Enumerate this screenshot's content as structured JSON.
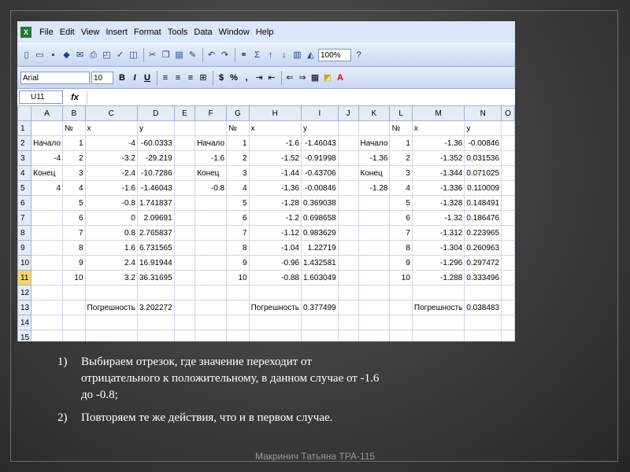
{
  "menu": [
    "File",
    "Edit",
    "View",
    "Insert",
    "Format",
    "Tools",
    "Data",
    "Window",
    "Help"
  ],
  "toolbar": {
    "zoom": "100%"
  },
  "format_toolbar": {
    "font": "Arial",
    "size": "10",
    "bold": "B",
    "italic": "I",
    "underline": "U",
    "currency": "$",
    "percent": "%",
    "comma": ","
  },
  "formula_bar": {
    "name_box": "U11",
    "fx": "fx"
  },
  "columns": [
    "A",
    "B",
    "C",
    "D",
    "E",
    "F",
    "G",
    "H",
    "I",
    "J",
    "K",
    "L",
    "M",
    "N",
    "O"
  ],
  "rows": [
    {
      "n": "1",
      "c": [
        "",
        "№",
        "x",
        "y",
        "",
        "",
        "№",
        "x",
        "y",
        "",
        "",
        "№",
        "x",
        "y",
        ""
      ]
    },
    {
      "n": "2",
      "c": [
        "Начало",
        "1",
        "-4",
        "-60.0333",
        "",
        "Начало",
        "1",
        "-1.6",
        "-1.46043",
        "",
        "Начало",
        "1",
        "-1.36",
        "-0.00846",
        ""
      ]
    },
    {
      "n": "3",
      "c": [
        "-4",
        "2",
        "-3.2",
        "-29.219",
        "",
        "-1.6",
        "2",
        "-1.52",
        "-0.91998",
        "",
        "-1.36",
        "2",
        "-1.352",
        "0.031536",
        ""
      ]
    },
    {
      "n": "4",
      "c": [
        "Конец",
        "3",
        "-2.4",
        "-10.7286",
        "",
        "Конец",
        "3",
        "-1.44",
        "-0.43706",
        "",
        "Конец",
        "3",
        "-1.344",
        "0.071025",
        ""
      ]
    },
    {
      "n": "5",
      "c": [
        "4",
        "4",
        "-1.6",
        "-1.46043",
        "",
        "-0.8",
        "4",
        "-1.36",
        "-0.00846",
        "",
        "-1.28",
        "4",
        "-1.336",
        "0.110009",
        ""
      ]
    },
    {
      "n": "6",
      "c": [
        "",
        "5",
        "-0.8",
        "1.741837",
        "",
        "",
        "5",
        "-1.28",
        "0.369038",
        "",
        "",
        "5",
        "-1.328",
        "0.148491",
        ""
      ]
    },
    {
      "n": "7",
      "c": [
        "",
        "6",
        "0",
        "2.09691",
        "",
        "",
        "6",
        "-1.2",
        "0.698658",
        "",
        "",
        "6",
        "-1.32",
        "0.186476",
        ""
      ]
    },
    {
      "n": "8",
      "c": [
        "",
        "7",
        "0.8",
        "2.765837",
        "",
        "",
        "7",
        "-1.12",
        "0.983629",
        "",
        "",
        "7",
        "-1.312",
        "0.223965",
        ""
      ]
    },
    {
      "n": "9",
      "c": [
        "",
        "8",
        "1.6",
        "6.731565",
        "",
        "",
        "8",
        "-1.04",
        "1.22719",
        "",
        "",
        "8",
        "-1.304",
        "0.260963",
        ""
      ]
    },
    {
      "n": "10",
      "c": [
        "",
        "9",
        "2.4",
        "16.91944",
        "",
        "",
        "9",
        "-0.96",
        "1.432581",
        "",
        "",
        "9",
        "-1.296",
        "0.297472",
        ""
      ]
    },
    {
      "n": "11",
      "c": [
        "",
        "10",
        "3.2",
        "36.31695",
        "",
        "",
        "10",
        "-0.88",
        "1.603049",
        "",
        "",
        "10",
        "-1.288",
        "0.333496",
        ""
      ]
    },
    {
      "n": "12",
      "c": [
        "",
        "",
        "",
        "",
        "",
        "",
        "",
        "",
        "",
        "",
        "",
        "",
        "",
        "",
        ""
      ]
    },
    {
      "n": "13",
      "c": [
        "",
        "",
        "Погрешность",
        "3.202272",
        "",
        "",
        "",
        "Погрешность",
        "0.377499",
        "",
        "",
        "",
        "Погрешность",
        "0.038483",
        ""
      ]
    },
    {
      "n": "14",
      "c": [
        "",
        "",
        "",
        "",
        "",
        "",
        "",
        "",
        "",
        "",
        "",
        "",
        "",
        "",
        ""
      ]
    },
    {
      "n": "15",
      "c": [
        "",
        "",
        "",
        "",
        "",
        "",
        "",
        "",
        "",
        "",
        "",
        "",
        "",
        "",
        ""
      ]
    }
  ],
  "selected_row": "11",
  "notes": {
    "item1_num": "1)",
    "item1_line1": "Выбираем отрезок, где значение переходит от",
    "item1_line2": "отрицательного к положительному, в данном случае от -1.6",
    "item1_line3": "до -0.8;",
    "item2_num": "2)",
    "item2_text": "Повторяем те же действия, что и в первом случае."
  },
  "footer": "Макринич Татьяна   ТРА-115"
}
